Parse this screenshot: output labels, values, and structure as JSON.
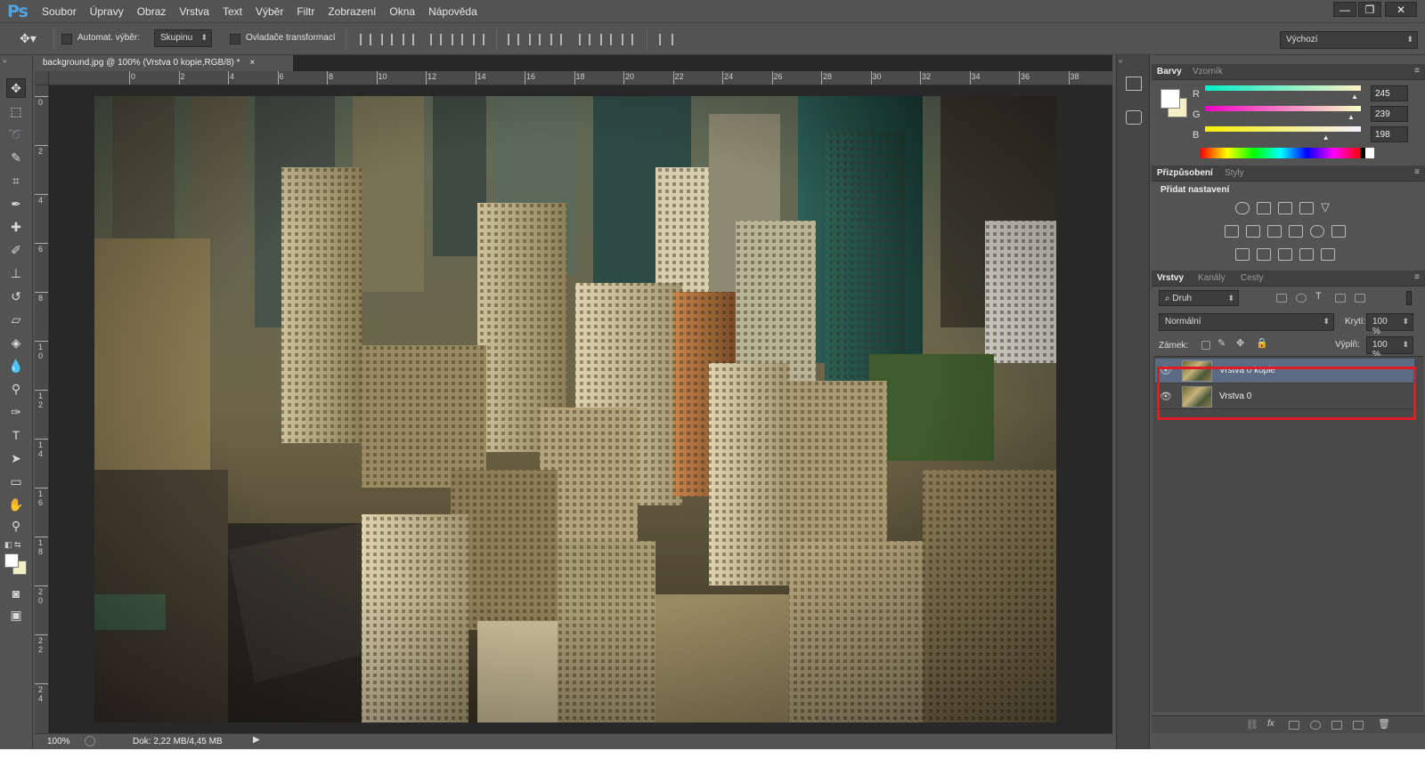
{
  "app": {
    "logo": "Ps"
  },
  "menu": [
    "Soubor",
    "Úpravy",
    "Obraz",
    "Vrstva",
    "Text",
    "Výběr",
    "Filtr",
    "Zobrazení",
    "Okna",
    "Nápověda"
  ],
  "window_controls": {
    "minimize": "—",
    "restore": "❐",
    "close": "✕"
  },
  "options_bar": {
    "auto_select_label": "Automat. výběr:",
    "auto_select_value": "Skupinu",
    "transform_label": "Ovladače transformací",
    "workspace": "Výchozí"
  },
  "document": {
    "tab_title": "background.jpg @ 100% (Vrstva 0 kopie,RGB/8) *",
    "close": "×",
    "zoom": "100%",
    "doc_size": "Dok: 2,22 MB/4,45 MB"
  },
  "ruler": {
    "top": [
      "0",
      "2",
      "4",
      "6",
      "8",
      "10",
      "12",
      "14",
      "16",
      "18",
      "20",
      "22",
      "24",
      "26",
      "28",
      "30",
      "32",
      "34",
      "36",
      "38"
    ],
    "left": [
      "0",
      "2",
      "4",
      "6",
      "8",
      "1\n0",
      "1\n2",
      "1\n4",
      "1\n6",
      "1\n8",
      "2\n0",
      "2\n2",
      "2\n4"
    ]
  },
  "colors_panel": {
    "tabs": [
      "Barvy",
      "Vzorník"
    ],
    "channels": [
      {
        "label": "R",
        "value": "245",
        "fraction": 0.961
      },
      {
        "label": "G",
        "value": "239",
        "fraction": 0.937
      },
      {
        "label": "B",
        "value": "198",
        "fraction": 0.776
      }
    ],
    "foreground": "#f5efc6",
    "background": "#ffffff"
  },
  "adjustments_panel": {
    "tabs": [
      "Přizpůsobení",
      "Styly"
    ],
    "heading": "Přidat nastavení"
  },
  "layers_panel": {
    "tabs": [
      "Vrstvy",
      "Kanály",
      "Cesty"
    ],
    "filter": "Druh",
    "blend_mode": "Normální",
    "opacity_label": "Krytí:",
    "opacity": "100 %",
    "lock_label": "Zámek:",
    "fill_label": "Výplň:",
    "fill": "100 %",
    "layers": [
      {
        "name": "Vrstva 0 kopie",
        "selected": true,
        "visible": true
      },
      {
        "name": "Vrstva 0",
        "selected": false,
        "visible": true
      }
    ],
    "highlight_color": "#e01b24"
  },
  "tools": [
    "move-tool",
    "marquee-tool",
    "lasso-tool",
    "quick-select-tool",
    "crop-tool",
    "eyedropper-tool",
    "healing-brush-tool",
    "brush-tool",
    "clone-stamp-tool",
    "history-brush-tool",
    "eraser-tool",
    "paint-bucket-tool",
    "blur-tool",
    "dodge-tool",
    "pen-tool",
    "type-tool",
    "path-select-tool",
    "shape-tool",
    "hand-tool",
    "zoom-tool"
  ]
}
